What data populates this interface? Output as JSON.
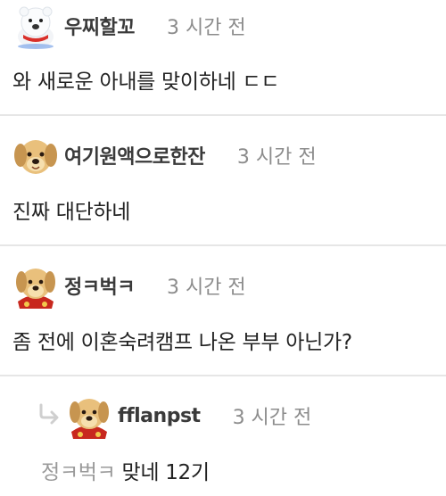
{
  "comments": [
    {
      "nickname": "우찌할꼬",
      "time": "3 시간 전",
      "text": "와 새로운 아내를 맞이하네 ㄷㄷ",
      "avatar": "polar-bear-avatar"
    },
    {
      "nickname": "여기원액으로한잔",
      "time": "3 시간 전",
      "text": "진짜 대단하네",
      "avatar": "puppy-avatar"
    },
    {
      "nickname": "정ㅋ벅ㅋ",
      "time": "3 시간 전",
      "text": "좀 전에 이혼숙려캠프 나온 부부 아닌가?",
      "avatar": "puppy-cape-avatar"
    }
  ],
  "reply": {
    "nickname": "fflanpst",
    "time": "3 시간 전",
    "mention": "정ㅋ벅ㅋ",
    "text": "맞네 12기",
    "avatar": "puppy-cape-avatar",
    "icon": "reply-arrow-icon"
  },
  "colors": {
    "divider": "#e6e6e6",
    "time": "#8c8c8c",
    "mention": "#9a9a9a"
  }
}
